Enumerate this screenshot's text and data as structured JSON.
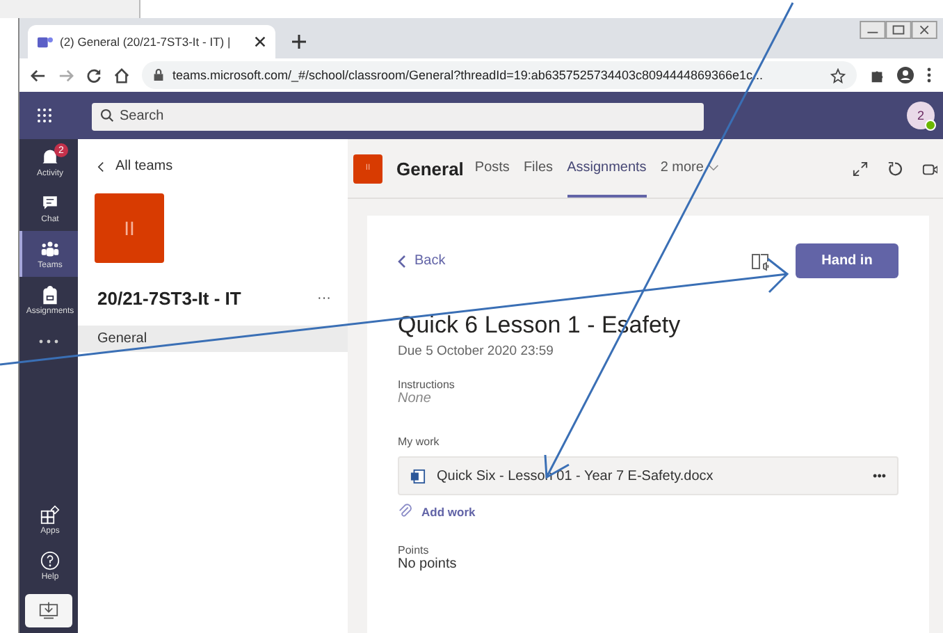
{
  "browser": {
    "tab": {
      "title": "(2) General (20/21-7ST3-It - IT) |"
    },
    "address": "teams.microsoft.com/_#/school/classroom/General?threadId=19:ab6357525734403c8094444869366e1c..."
  },
  "header": {
    "search": {
      "placeholder": "Search"
    },
    "avatar": "2"
  },
  "rail": [
    {
      "label": "Activity",
      "badge": "2",
      "selected": false
    },
    {
      "label": "Chat",
      "selected": false
    },
    {
      "label": "Teams",
      "selected": true
    },
    {
      "label": "Assignments",
      "selected": false
    },
    {
      "label": "Apps",
      "selected": false
    },
    {
      "label": "Help",
      "selected": false
    }
  ],
  "team_panel": {
    "back": "All teams",
    "tile": "II",
    "name": "20/21-7ST3-It - IT",
    "more": "···",
    "channels": [
      {
        "name": "General",
        "selected": true
      }
    ]
  },
  "channel_header": {
    "tile": "II",
    "name": "General",
    "tabs": [
      {
        "label": "Posts",
        "selected": false
      },
      {
        "label": "Files",
        "selected": false
      },
      {
        "label": "Assignments",
        "selected": true
      },
      {
        "label": "2 more",
        "selected": false
      }
    ]
  },
  "assignment": {
    "back": "Back",
    "hand_in": "Hand in",
    "title": "Quick 6 Lesson 1 - Esafety",
    "due": "Due 5 October 2020 23:59",
    "instructions_label": "Instructions",
    "instructions": "None",
    "my_work_label": "My work",
    "file": "Quick Six - Lesson 01 - Year 7 E-Safety.docx",
    "file_more": "•••",
    "add_work": "Add work",
    "points_label": "Points",
    "points": "No points"
  }
}
